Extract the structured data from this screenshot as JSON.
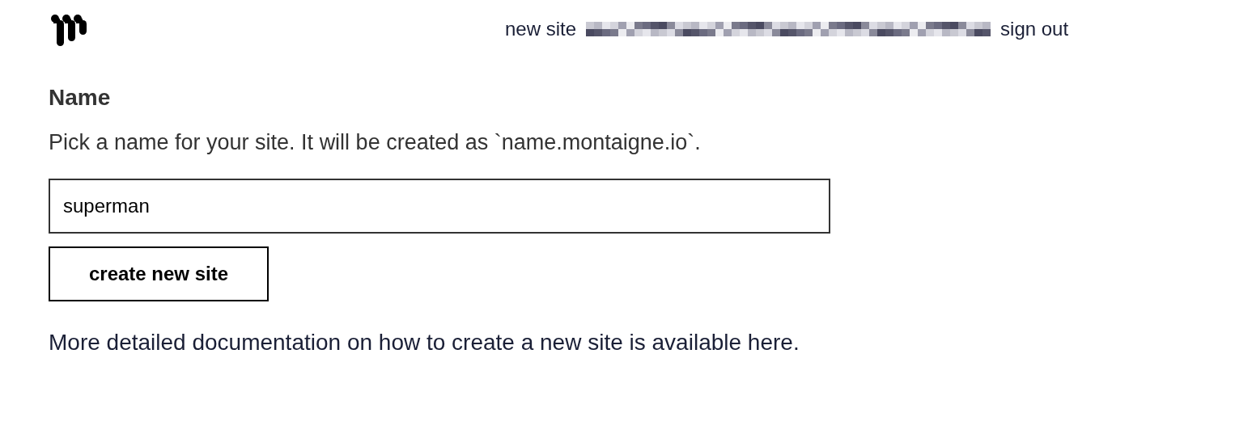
{
  "header": {
    "nav": [
      {
        "label": "new site"
      },
      {
        "label": "sign out"
      }
    ]
  },
  "form": {
    "heading": "Name",
    "description": "Pick a name for your site. It will be created as `name.montaigne.io`.",
    "input": {
      "value": "superman"
    },
    "button": "create new site"
  },
  "documentation": {
    "text": "More detailed documentation on how to create a new site is available ",
    "link": "here",
    "end": "."
  }
}
